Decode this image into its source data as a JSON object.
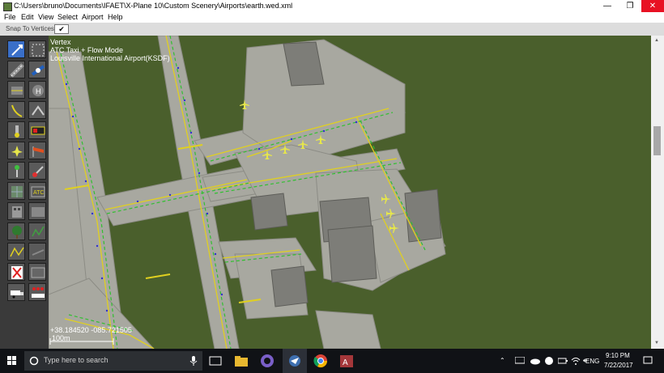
{
  "window": {
    "title": "C:\\Users\\bruno\\Documents\\IFAET\\X-Plane 10\\Custom Scenery\\Airports\\earth.wed.xml",
    "minimize": "—",
    "maximize": "❐",
    "close": "✕"
  },
  "menu": [
    "File",
    "Edit",
    "View",
    "Select",
    "Airport",
    "Help"
  ],
  "options": {
    "snap_label": "Snap To Vertices",
    "snap_checked": "✔"
  },
  "map": {
    "info_lines": [
      "Vertex",
      "ATC Taxi + Flow Mode",
      "Louisville International Airport(KSDF)"
    ],
    "coords": "+38.184520 -085.721505",
    "scale": "100m"
  },
  "tools": [
    {
      "name": "vertex-tool-icon",
      "active": true
    },
    {
      "name": "marquee-tool-icon",
      "active": false
    },
    {
      "name": "runway-tool-icon",
      "active": false
    },
    {
      "name": "sealane-tool-icon",
      "active": false
    },
    {
      "name": "taxiway-tool-icon",
      "active": false
    },
    {
      "name": "helipad-tool-icon",
      "active": false
    },
    {
      "name": "taxi-line-tool-icon",
      "active": false
    },
    {
      "name": "boundary-tool-icon",
      "active": false
    },
    {
      "name": "light-fixture-tool-icon",
      "active": false
    },
    {
      "name": "sign-tool-icon",
      "active": false
    },
    {
      "name": "ramp-start-tool-icon",
      "active": false
    },
    {
      "name": "windsock-tool-icon",
      "active": false
    },
    {
      "name": "beacon-tool-icon",
      "active": false
    },
    {
      "name": "tower-viewpoint-tool-icon",
      "active": false
    },
    {
      "name": "object-tool-icon",
      "active": false
    },
    {
      "name": "atc-taxi-route-tool-icon",
      "active": false
    },
    {
      "name": "facade-tool-icon",
      "active": false
    },
    {
      "name": "polygon-tool-icon",
      "active": false
    },
    {
      "name": "forest-tool-icon",
      "active": false
    },
    {
      "name": "draped-line-tool-icon",
      "active": false
    },
    {
      "name": "string-tool-icon",
      "active": false
    },
    {
      "name": "line-tool-icon",
      "active": false
    },
    {
      "name": "exclusion-tool-icon",
      "active": false
    },
    {
      "name": "autogen-tool-icon",
      "active": false
    },
    {
      "name": "truck-parking-tool-icon",
      "active": false
    },
    {
      "name": "truck-destination-tool-icon",
      "active": false
    }
  ],
  "atc_label": "ATC",
  "taskbar": {
    "search_placeholder": "Type here to search",
    "language": "ENG",
    "time": "9:10 PM",
    "date": "7/22/2017"
  },
  "colors": {
    "grass": "#4a5f2c",
    "pavement": "#a8a8a0",
    "taxi_line": "#e0d020",
    "taxi_route": "#30c030",
    "aircraft": "#e6e64a",
    "taskbar": "#101216",
    "toolbar": "#3a3a3a"
  }
}
